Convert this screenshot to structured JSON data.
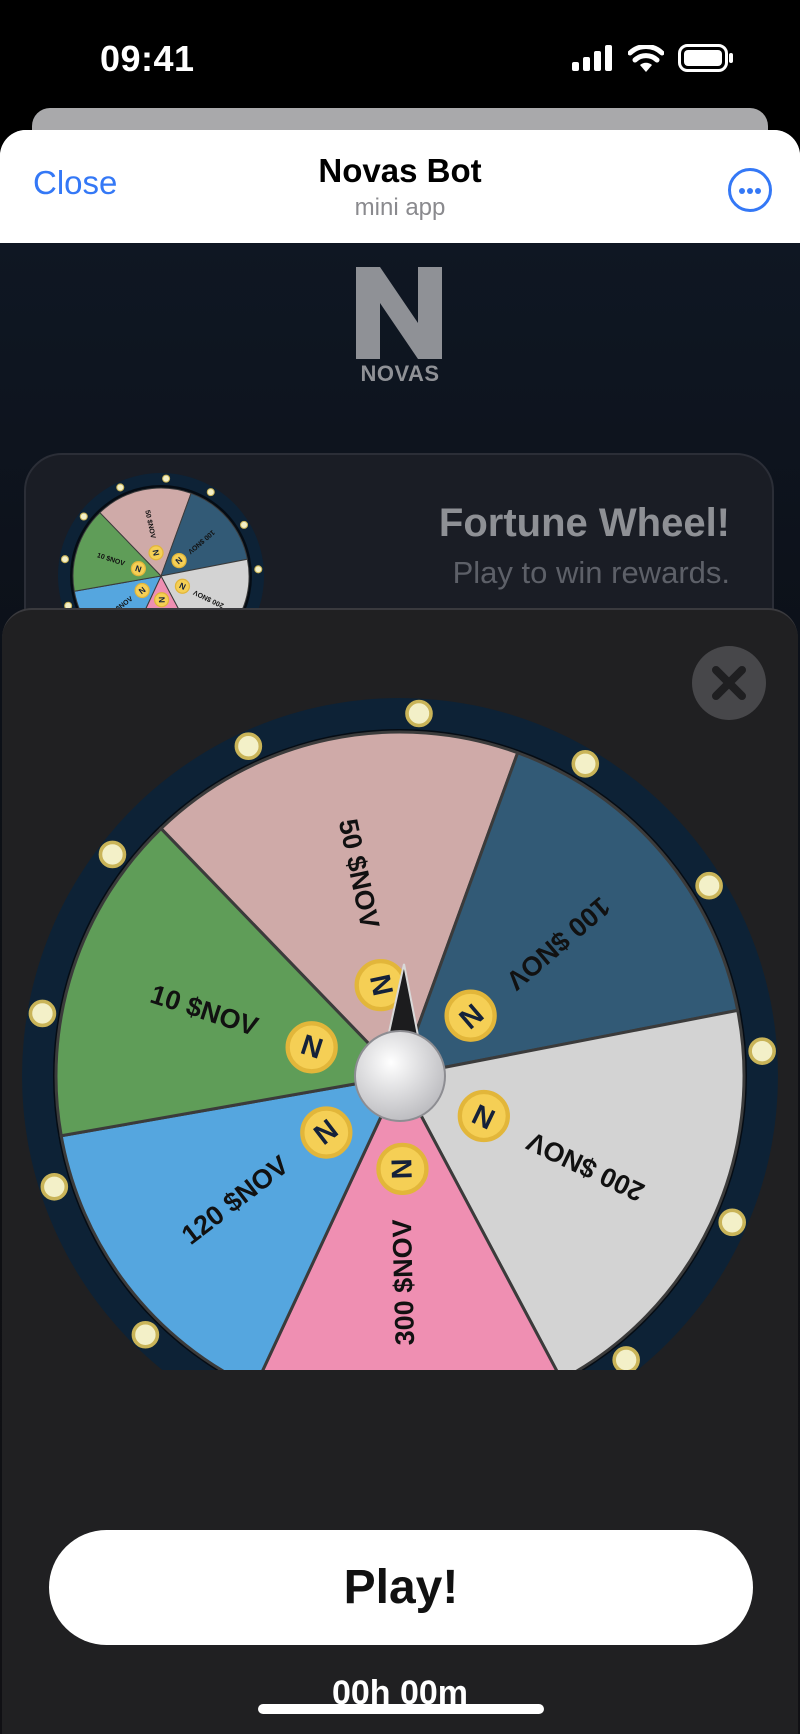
{
  "status_bar": {
    "time": "09:41",
    "icons": [
      "signal-icon",
      "wifi-icon",
      "battery-icon"
    ]
  },
  "header": {
    "close_label": "Close",
    "title": "Novas Bot",
    "subtitle": "mini app",
    "more_icon": "more-icon"
  },
  "brand": {
    "logo_letter": "N",
    "logo_text": "NOVAS"
  },
  "promo": {
    "title": "Fortune Wheel!",
    "subtitle": "Play to win rewards."
  },
  "wheel": {
    "segments": [
      {
        "label": "50 $NOV",
        "color": "#cfaaa8"
      },
      {
        "label": "100 $NOV",
        "color": "#325a76"
      },
      {
        "label": "200 $NOV",
        "color": "#d3d3d3"
      },
      {
        "label": "300 $NOV",
        "color": "#ef8fb2"
      },
      {
        "label": "120 $NOV",
        "color": "#55a6df"
      },
      {
        "label": "10 $NOV",
        "color": "#5f9d58"
      }
    ],
    "coin_letter": "N",
    "rim_color": "#0d2236",
    "coin_color": "#f5cf55"
  },
  "actions": {
    "play_label": "Play!",
    "timer_text": "00h 00m"
  }
}
